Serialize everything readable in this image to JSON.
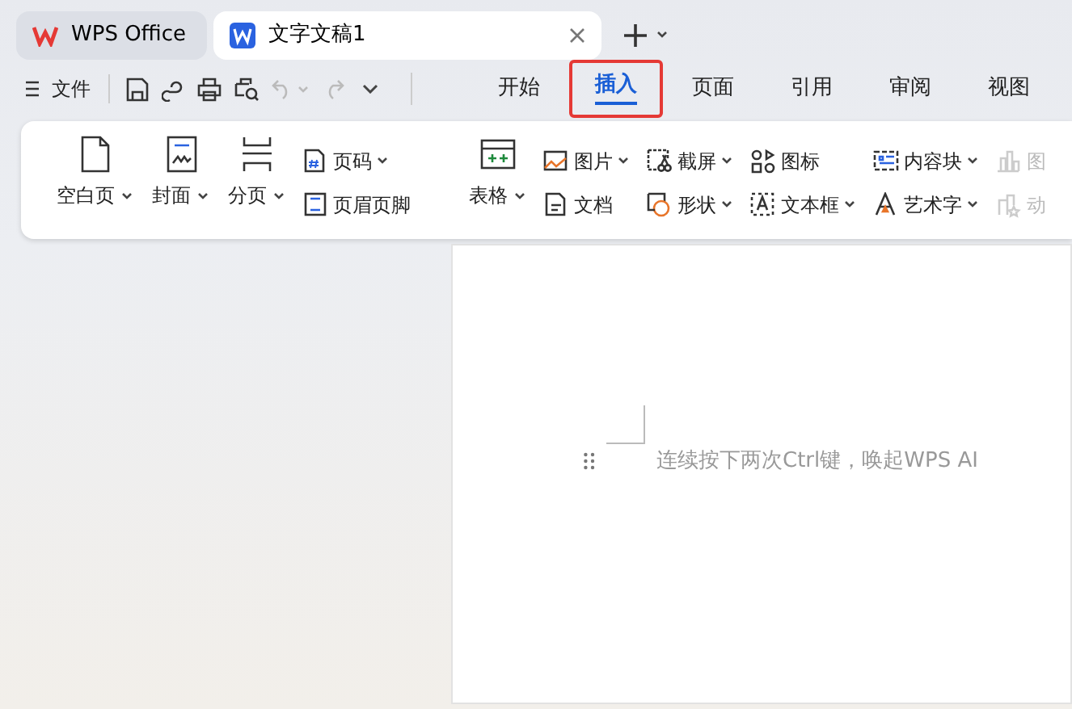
{
  "tabs": [
    {
      "label": "WPS Office",
      "kind": "home",
      "selected": false
    },
    {
      "label": "文字文稿1",
      "kind": "document",
      "selected": true
    }
  ],
  "file_menu": {
    "label": "文件"
  },
  "ribbon_tabs": [
    {
      "label": "开始",
      "selected": false
    },
    {
      "label": "插入",
      "selected": true
    },
    {
      "label": "页面",
      "selected": false
    },
    {
      "label": "引用",
      "selected": false
    },
    {
      "label": "审阅",
      "selected": false
    },
    {
      "label": "视图",
      "selected": false
    }
  ],
  "ribbon_groups": [
    {
      "columns": [
        {
          "kind": "large",
          "items": [
            {
              "label": "空白页",
              "dropdown": true,
              "disabled": false
            }
          ]
        },
        {
          "kind": "large",
          "items": [
            {
              "label": "封面",
              "dropdown": true,
              "disabled": false
            }
          ]
        },
        {
          "kind": "large",
          "items": [
            {
              "label": "分页",
              "dropdown": true,
              "disabled": false
            }
          ]
        },
        {
          "kind": "stack",
          "items": [
            {
              "label": "页码",
              "dropdown": true,
              "disabled": false
            },
            {
              "label": "页眉页脚",
              "dropdown": false,
              "disabled": false
            }
          ]
        }
      ]
    },
    {
      "columns": [
        {
          "kind": "large",
          "items": [
            {
              "label": "表格",
              "dropdown": true,
              "disabled": false
            }
          ]
        },
        {
          "kind": "stack",
          "items": [
            {
              "label": "图片",
              "dropdown": true,
              "disabled": false
            },
            {
              "label": "文档",
              "dropdown": false,
              "disabled": false
            }
          ]
        },
        {
          "kind": "stack",
          "items": [
            {
              "label": "截屏",
              "dropdown": true,
              "disabled": false
            },
            {
              "label": "形状",
              "dropdown": true,
              "disabled": false
            }
          ]
        },
        {
          "kind": "stack",
          "items": [
            {
              "label": "图标",
              "dropdown": false,
              "disabled": false
            },
            {
              "label": "文本框",
              "dropdown": true,
              "disabled": false
            }
          ]
        },
        {
          "kind": "stack",
          "items": [
            {
              "label": "内容块",
              "dropdown": true,
              "disabled": false
            },
            {
              "label": "艺术字",
              "dropdown": true,
              "disabled": false
            }
          ]
        },
        {
          "kind": "stack",
          "items": [
            {
              "label": "图",
              "dropdown": false,
              "disabled": true
            },
            {
              "label": "动",
              "dropdown": false,
              "disabled": true
            }
          ]
        }
      ]
    }
  ],
  "document": {
    "hint": "连续按下两次Ctrl键，唤起WPS AI"
  }
}
